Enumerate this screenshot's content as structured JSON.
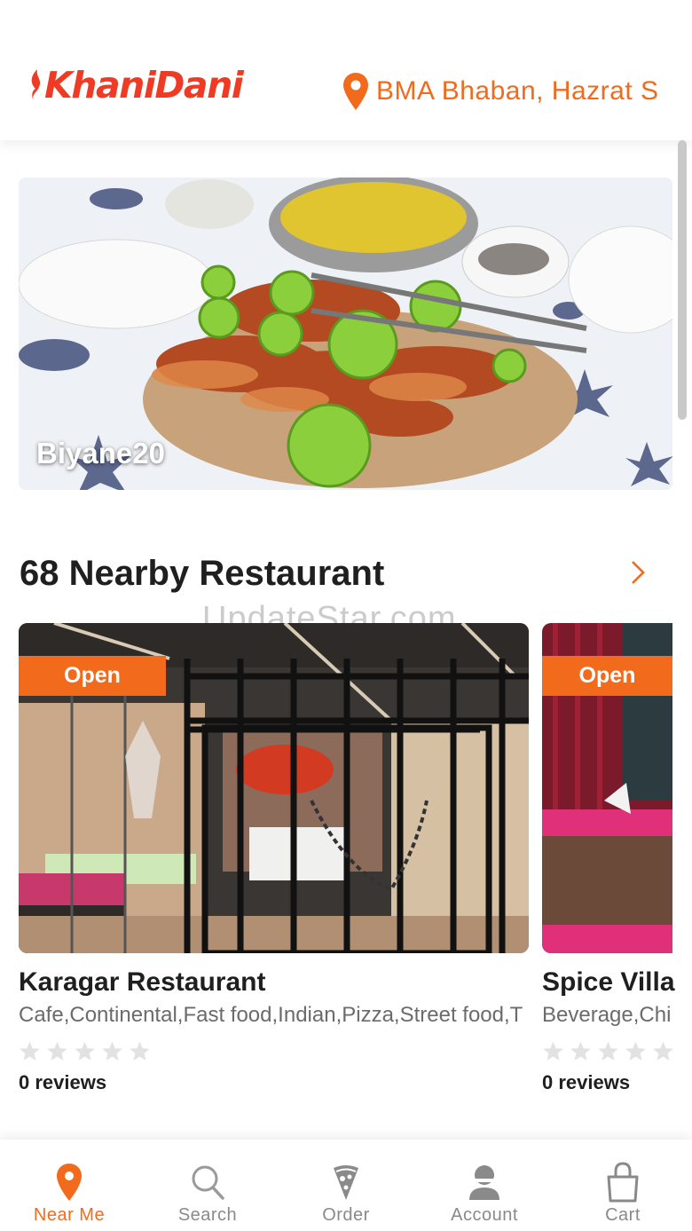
{
  "header": {
    "logo_text": "KhaniDani",
    "location_text": "BMA Bhaban, Hazrat S",
    "brand_color": "#ef3b24",
    "accent_color": "#f26b1d"
  },
  "banner": {
    "label": "Biyane20"
  },
  "nearby": {
    "title": "68 Nearby Restaurant",
    "watermark": "UpdateStar.com"
  },
  "restaurants": [
    {
      "status": "Open",
      "name": "Karagar Restaurant",
      "cuisines": "Cafe,Continental,Fast food,Indian,Pizza,Street food,T",
      "rating": 0,
      "reviews": "0 reviews"
    },
    {
      "status": "Open",
      "name": "Spice Villa",
      "cuisines": "Beverage,Chi",
      "rating": 0,
      "reviews": "0 reviews"
    }
  ],
  "bottom_nav": [
    {
      "label": "Near Me",
      "icon": "location-pin-icon",
      "active": true
    },
    {
      "label": "Search",
      "icon": "search-icon",
      "active": false
    },
    {
      "label": "Order",
      "icon": "pizza-icon",
      "active": false
    },
    {
      "label": "Account",
      "icon": "user-icon",
      "active": false
    },
    {
      "label": "Cart",
      "icon": "shopping-bag-icon",
      "active": false
    }
  ]
}
